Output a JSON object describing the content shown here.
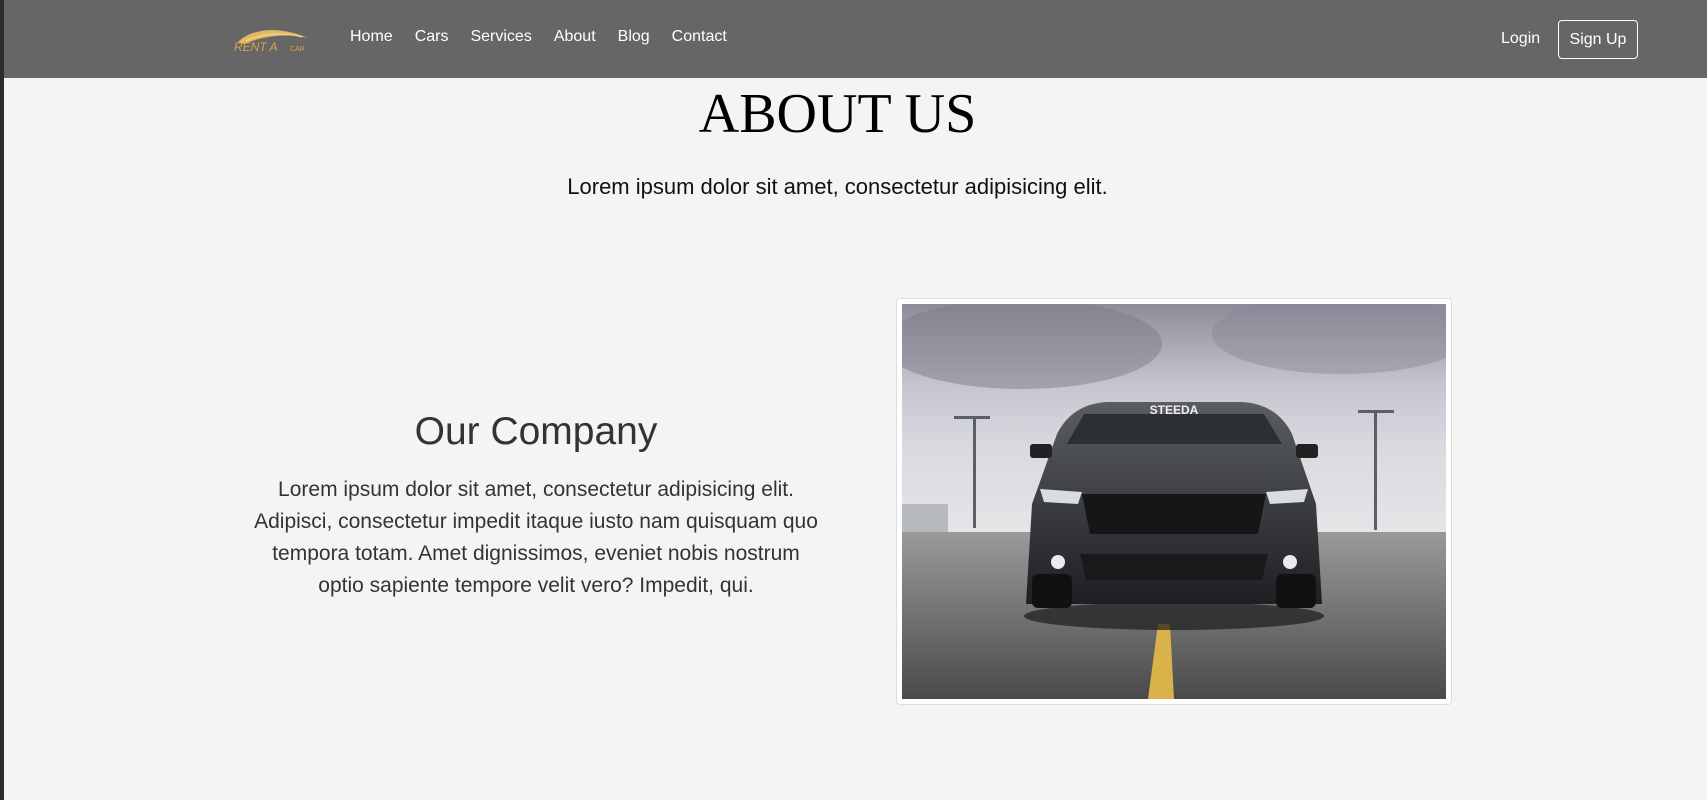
{
  "navbar": {
    "logo": {
      "text_main": "RENT A",
      "text_small": "CAR",
      "color": "#d6a64a"
    },
    "links": [
      "Home",
      "Cars",
      "Services",
      "About",
      "Blog",
      "Contact"
    ],
    "login_label": "Login",
    "signup_label": "Sign Up",
    "background": "#666666"
  },
  "hero": {
    "title": "ABOUT US",
    "subtitle": "Lorem ipsum dolor sit amet, consectetur adipisicing elit."
  },
  "company": {
    "heading": "Our Company",
    "body": "Lorem ipsum dolor sit amet, consectetur adipisicing elit. Adipisci, consectetur impedit itaque iusto nam quisquam quo tempora totam. Amet dignissimos, eveniet nobis nostrum optio sapiente tempore velit vero? Impedit, qui."
  },
  "photo": {
    "windshield_text": "STEEDA"
  }
}
